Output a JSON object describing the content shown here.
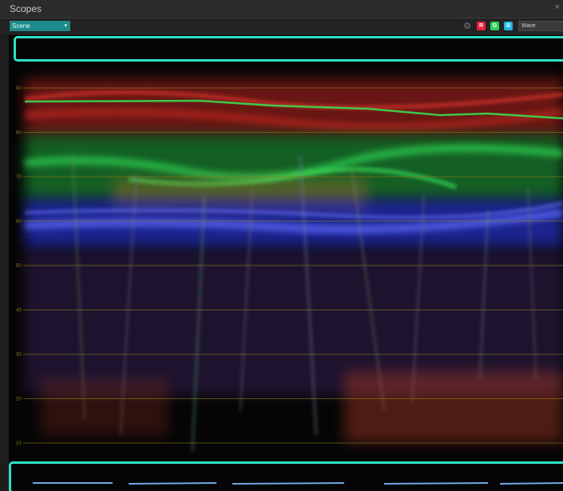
{
  "window": {
    "title": "Scopes",
    "close_glyph": "×"
  },
  "toolbar": {
    "scope_select_value": "Scene",
    "settings_icon": "settings-icon",
    "channel_r_label": "R",
    "channel_g_label": "G",
    "channel_b_label": "B",
    "mode_select_value": "Wave"
  },
  "scale": {
    "ticks": [
      "90",
      "80",
      "70",
      "60",
      "50",
      "40",
      "30",
      "20",
      "10"
    ],
    "grid_color": "#8a7a18"
  },
  "colors": {
    "accent": "#1e8a8a",
    "highlight": "#2fe0c8",
    "red_trace": "#e8213f",
    "green_trace": "#2fcf5a",
    "blue_trace": "#4a5cff"
  }
}
